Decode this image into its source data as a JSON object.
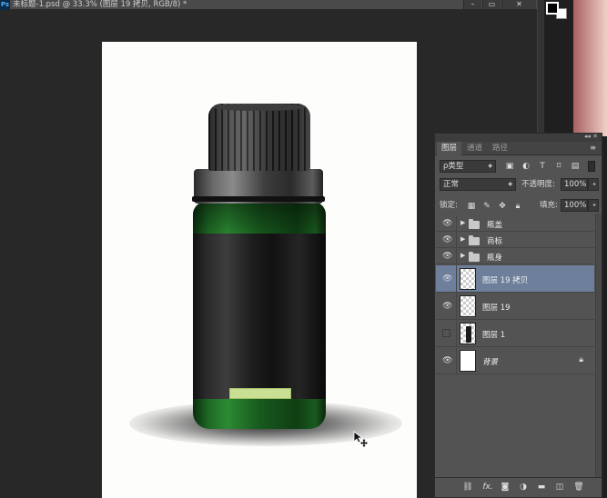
{
  "title_bar": {
    "app_badge": "Ps",
    "document_title": "未标题-1.psd @ 33.3% (图层 19 拷贝, RGB/8) *",
    "minimize": "–",
    "restore": "▭",
    "close": "✕"
  },
  "panel": {
    "collapse": "◂◂ ✕",
    "tabs": [
      {
        "label": "图层",
        "active": true
      },
      {
        "label": "通道",
        "active": false
      },
      {
        "label": "路径",
        "active": false
      }
    ],
    "menu_icon": "≡",
    "filter": {
      "label": "ρ类型",
      "arrow": "◆"
    },
    "blend_mode": {
      "value": "正常",
      "arrow": "◆"
    },
    "opacity": {
      "label": "不透明度:",
      "value": "100%"
    },
    "lock": {
      "label": "锁定:"
    },
    "fill": {
      "label": "填充:",
      "value": "100%"
    },
    "layers": [
      {
        "name": "瓶盖",
        "type": "group",
        "visible": true,
        "selected": false
      },
      {
        "name": "商标",
        "type": "group",
        "visible": true,
        "selected": false
      },
      {
        "name": "瓶身",
        "type": "group",
        "visible": true,
        "selected": false
      },
      {
        "name": "图层 19 拷贝",
        "type": "layer",
        "visible": true,
        "selected": true
      },
      {
        "name": "图层 19",
        "type": "layer",
        "visible": true,
        "selected": false
      },
      {
        "name": "图层 1",
        "type": "layer",
        "visible": false,
        "selected": false
      },
      {
        "name": "背景",
        "type": "background",
        "visible": true,
        "selected": false,
        "locked": true
      }
    ],
    "bottom_icons": [
      "link-icon",
      "fx-icon",
      "mask-icon",
      "adjustment-icon",
      "group-icon",
      "new-layer-icon",
      "trash-icon"
    ],
    "fx_label": "fx."
  },
  "colors": {
    "panel_bg": "#535353",
    "selected_layer": "#6d7f9b",
    "workspace": "#282828",
    "label_sticker": "#c9e094"
  }
}
